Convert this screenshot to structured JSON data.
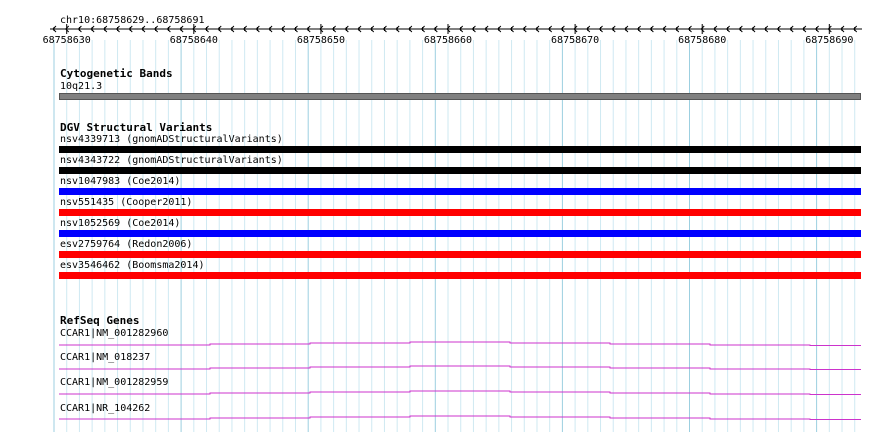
{
  "ruler": {
    "location": "chr10:68758629..68758691",
    "ticks": [
      "68758630",
      "68758640",
      "68758650",
      "68758660",
      "68758670",
      "68758680",
      "68758690"
    ]
  },
  "cytoband": {
    "title": "Cytogenetic Bands",
    "band": "10q21.3",
    "color": "#808080"
  },
  "dgv": {
    "title": "DGV Structural Variants",
    "variants": [
      {
        "label": "nsv4339713 (gnomADStructuralVariants)",
        "color": "#000000"
      },
      {
        "label": "nsv4343722 (gnomADStructuralVariants)",
        "color": "#000000"
      },
      {
        "label": "nsv1047983 (Coe2014)",
        "color": "#0000ff"
      },
      {
        "label": "nsv551435 (Cooper2011)",
        "color": "#ff0000"
      },
      {
        "label": "nsv1052569 (Coe2014)",
        "color": "#0000ff"
      },
      {
        "label": "esv2759764 (Redon2006)",
        "color": "#ff0000"
      },
      {
        "label": "esv3546462 (Boomsma2014)",
        "color": "#ff0000"
      }
    ]
  },
  "refseq": {
    "title": "RefSeq Genes",
    "genes": [
      {
        "label": "CCAR1|NM_001282960"
      },
      {
        "label": "CCAR1|NM_018237"
      },
      {
        "label": "CCAR1|NM_001282959"
      },
      {
        "label": "CCAR1|NR_104262"
      }
    ],
    "color": "#cc33cc"
  }
}
